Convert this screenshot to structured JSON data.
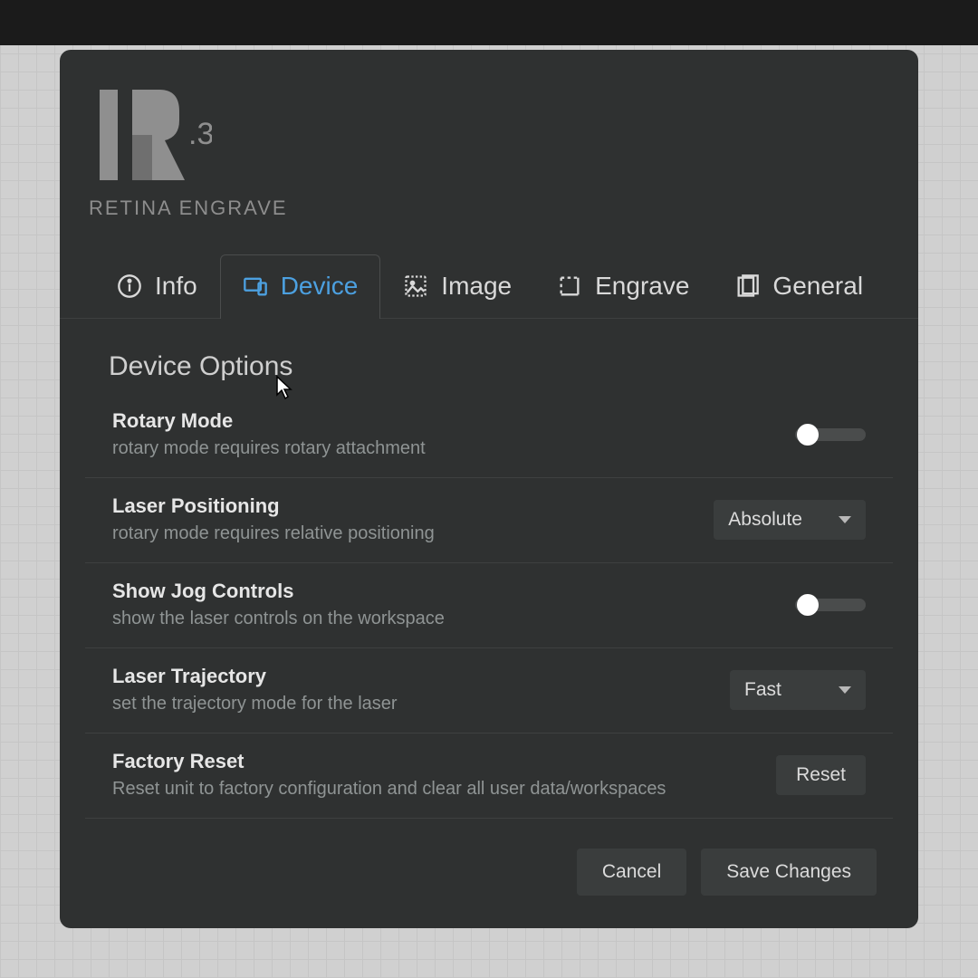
{
  "brand": {
    "name_bold": "RETINA",
    "name_light": "ENGRAVE",
    "logo_sub": ".3"
  },
  "tabs": [
    {
      "label": "Info"
    },
    {
      "label": "Device"
    },
    {
      "label": "Image"
    },
    {
      "label": "Engrave"
    },
    {
      "label": "General"
    }
  ],
  "section_title": "Device Options",
  "options": {
    "rotary": {
      "title": "Rotary Mode",
      "sub": "rotary mode requires rotary attachment",
      "value": false
    },
    "positioning": {
      "title": "Laser Positioning",
      "sub": "rotary mode requires relative positioning",
      "value": "Absolute"
    },
    "jog": {
      "title": "Show Jog Controls",
      "sub": "show the laser controls on the workspace",
      "value": false
    },
    "trajectory": {
      "title": "Laser Trajectory",
      "sub": "set the trajectory mode for the laser",
      "value": "Fast"
    },
    "reset": {
      "title": "Factory Reset",
      "sub": "Reset unit to factory configuration and clear all user data/workspaces",
      "button": "Reset"
    }
  },
  "footer": {
    "cancel": "Cancel",
    "save": "Save Changes"
  }
}
